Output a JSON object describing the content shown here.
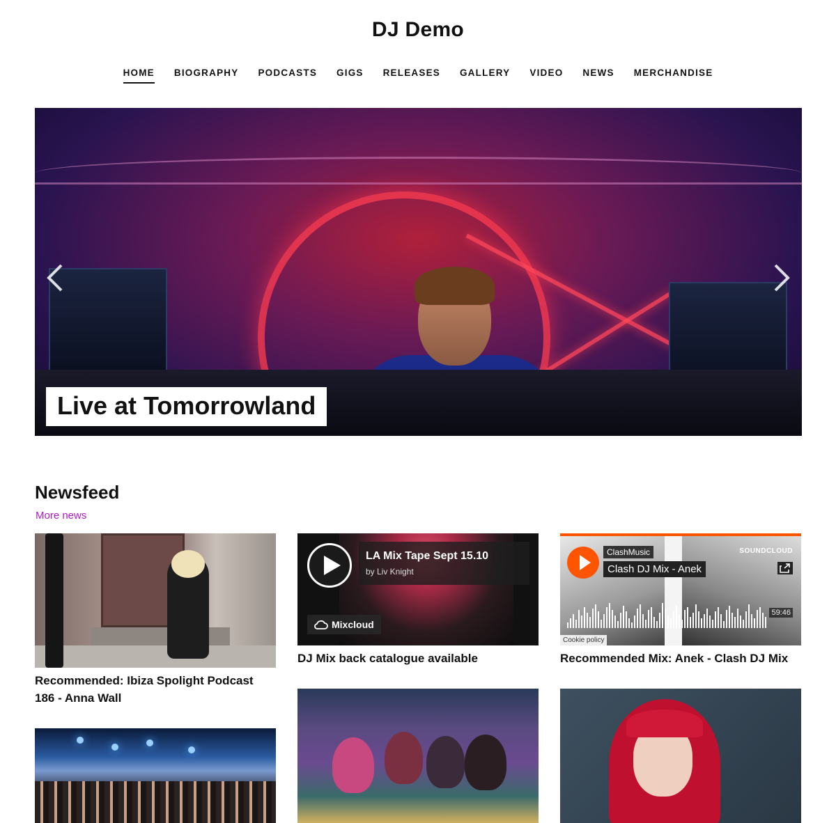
{
  "site": {
    "title": "DJ Demo"
  },
  "nav": {
    "items": [
      "HOME",
      "BIOGRAPHY",
      "PODCASTS",
      "GIGS",
      "RELEASES",
      "GALLERY",
      "VIDEO",
      "NEWS",
      "MERCHANDISE"
    ],
    "active": "HOME"
  },
  "hero": {
    "caption": "Live at Tomorrowland",
    "prev_icon": "chevron-left-icon",
    "next_icon": "chevron-right-icon"
  },
  "newsfeed": {
    "title": "Newsfeed",
    "more_link": "More news",
    "accent_color": "#b01ac8",
    "cards": [
      {
        "title": "Recommended: Ibiza Spolight Podcast 186 - Anna Wall"
      },
      {
        "title": "DJ Mix back catalogue available",
        "embed": {
          "provider": "Mixcloud",
          "track_title": "LA Mix Tape Sept 15.10",
          "byline": "by Liv Knight"
        }
      },
      {
        "title": "Recommended Mix: Anek - Clash DJ Mix",
        "embed": {
          "provider": "SOUNDCLOUD",
          "user": "ClashMusic",
          "track_title": "Clash DJ Mix - Anek",
          "duration": "59:46",
          "cookie": "Cookie policy",
          "brand_color": "#ff5500"
        }
      }
    ]
  }
}
